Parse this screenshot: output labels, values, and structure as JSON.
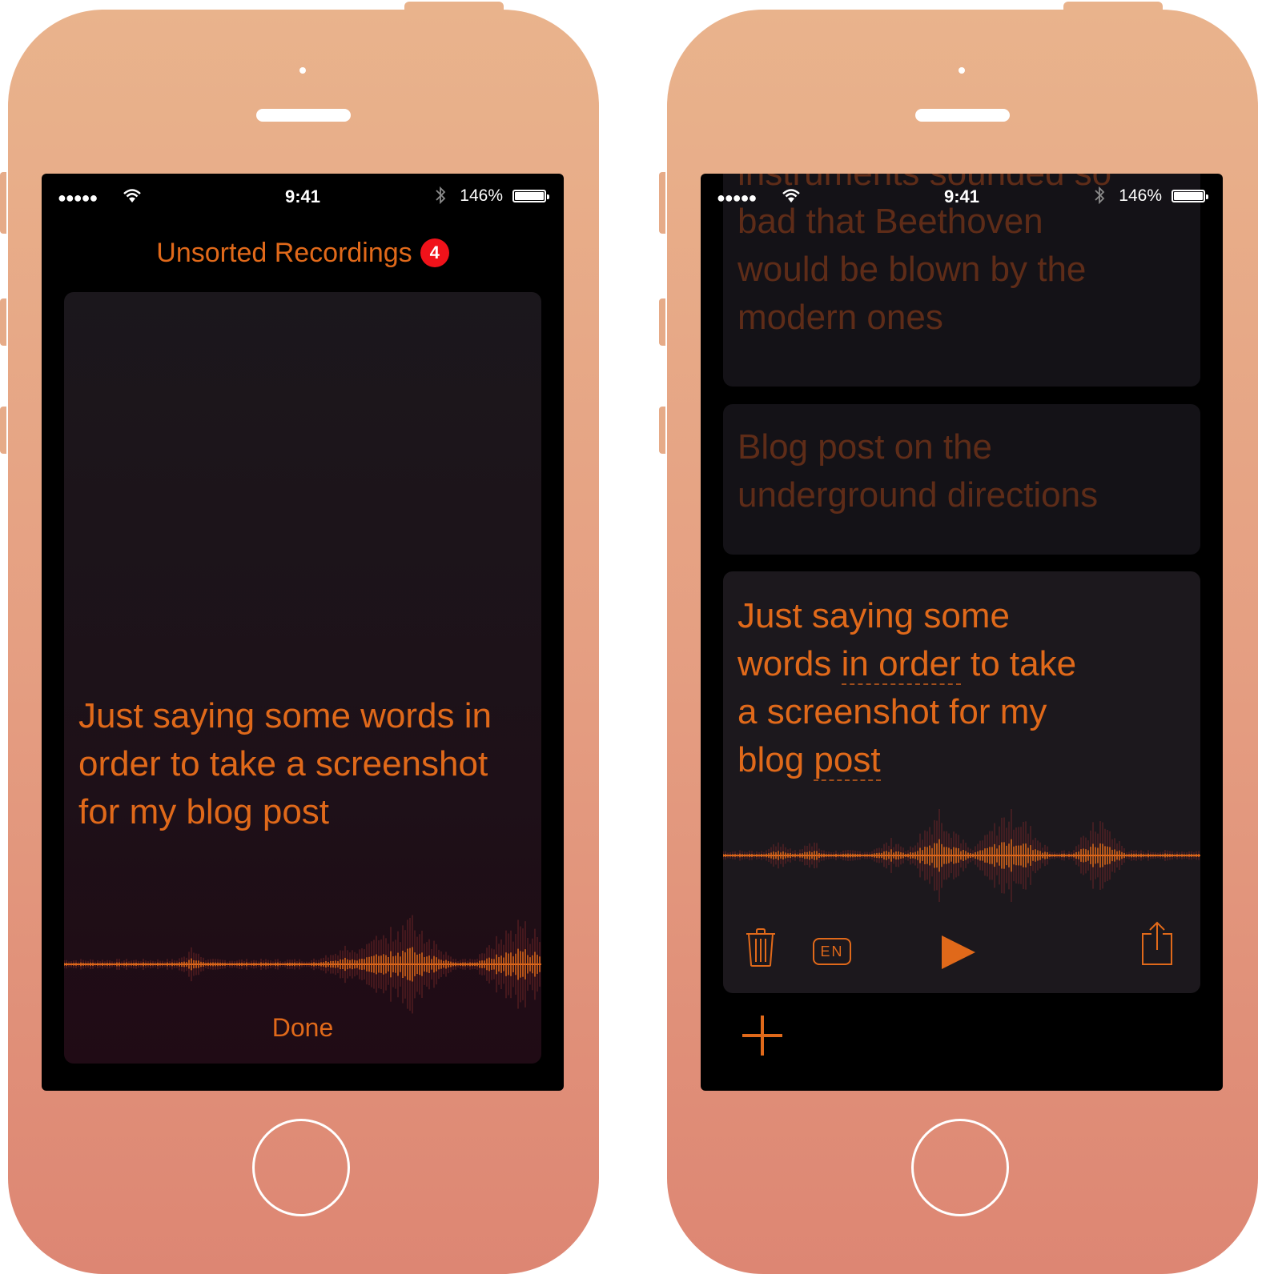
{
  "status_bar": {
    "signal": "●●●●●",
    "wifi_icon": "wifi-icon",
    "time": "9:41",
    "bluetooth_icon": "bluetooth-icon",
    "battery_percent": "146%",
    "battery_level": 1.0
  },
  "left_screen": {
    "title": "Unsorted Recordings",
    "badge_count": "4",
    "transcript": "Just saying some words in order to take a screenshot for my blog post",
    "done_label": "Done"
  },
  "right_screen": {
    "cards": [
      {
        "lines": [
          "instruments sounded so",
          "bad that Beethoven",
          "would be blown by the",
          "modern ones"
        ],
        "state": "faded"
      },
      {
        "lines": [
          "Blog post on the",
          "underground directions"
        ],
        "state": "faded"
      },
      {
        "line1": "Just saying some",
        "line2_pre": "words ",
        "line2_highlight": "in order",
        "line2_post": " to take",
        "line3": "a screenshot for my",
        "line4_pre": "blog ",
        "line4_highlight": "post",
        "state": "active"
      }
    ],
    "toolbar": {
      "delete_icon": "trash-icon",
      "language_label": "EN",
      "play_icon": "play-icon",
      "share_icon": "share-icon"
    },
    "add_icon": "plus-icon"
  },
  "colors": {
    "accent": "#e0691a",
    "faded_text": "#5e2c18",
    "badge": "#f0121a",
    "phone_top": "#e9b38c",
    "phone_bottom": "#dd8673"
  }
}
